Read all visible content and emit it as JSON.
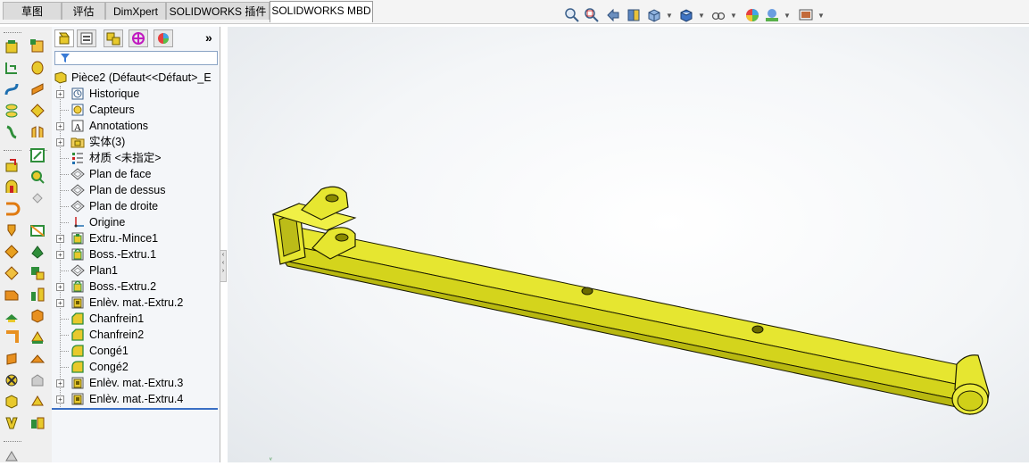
{
  "tabs": [
    {
      "label": "草图",
      "active": false
    },
    {
      "label": "评估",
      "active": false
    },
    {
      "label": "DimXpert",
      "active": false
    },
    {
      "label": "SOLIDWORKS 插件",
      "active": false
    },
    {
      "label": "SOLIDWORKS MBD",
      "active": true
    }
  ],
  "view_toolbar": {
    "icons": [
      "zoom-to-fit-icon",
      "zoom-to-area-icon",
      "previous-view-icon",
      "section-view-icon",
      "view-orientation-icon",
      "display-style-icon",
      "hide-show-items-icon",
      "edit-appearance-icon",
      "apply-scene-icon",
      "view-settings-icon"
    ]
  },
  "feature_manager": {
    "tabs": [
      "feature-manager-tab",
      "property-manager-tab",
      "configuration-manager-tab",
      "dimxpert-manager-tab",
      "display-manager-tab"
    ],
    "overflow": "»",
    "root": "Pièce2  (Défaut<<Défaut>_E",
    "items": [
      {
        "label": "Historique",
        "icon": "history-icon",
        "expand": true
      },
      {
        "label": "Capteurs",
        "icon": "sensor-icon",
        "expand": false
      },
      {
        "label": "Annotations",
        "icon": "annotations-icon",
        "expand": true
      },
      {
        "label": "实体(3)",
        "icon": "solid-bodies-folder-icon",
        "expand": true
      },
      {
        "label": "材质 <未指定>",
        "icon": "material-icon",
        "expand": false
      },
      {
        "label": "Plan de face",
        "icon": "plane-icon",
        "expand": false
      },
      {
        "label": "Plan de dessus",
        "icon": "plane-icon",
        "expand": false
      },
      {
        "label": "Plan de droite",
        "icon": "plane-icon",
        "expand": false
      },
      {
        "label": "Origine",
        "icon": "origin-icon",
        "expand": false
      },
      {
        "label": "Extru.-Mince1",
        "icon": "extrude-thin-icon",
        "expand": true
      },
      {
        "label": "Boss.-Extru.1",
        "icon": "boss-extrude-icon",
        "expand": true
      },
      {
        "label": "Plan1",
        "icon": "plane-icon",
        "expand": false
      },
      {
        "label": "Boss.-Extru.2",
        "icon": "boss-extrude-icon",
        "expand": true
      },
      {
        "label": "Enlèv. mat.-Extru.2",
        "icon": "cut-extrude-icon",
        "expand": true
      },
      {
        "label": "Chanfrein1",
        "icon": "chamfer-icon",
        "expand": false
      },
      {
        "label": "Chanfrein2",
        "icon": "chamfer-icon",
        "expand": false
      },
      {
        "label": "Congé1",
        "icon": "fillet-icon",
        "expand": false
      },
      {
        "label": "Congé2",
        "icon": "fillet-icon",
        "expand": false
      },
      {
        "label": "Enlèv. mat.-Extru.3",
        "icon": "cut-extrude-icon",
        "expand": true
      },
      {
        "label": "Enlèv. mat.-Extru.4",
        "icon": "cut-extrude-icon",
        "expand": true
      }
    ]
  },
  "colors": {
    "part_yellow": "#e8e832",
    "part_edge": "#1a1a00",
    "tree_rollback": "#3a6fc4"
  }
}
